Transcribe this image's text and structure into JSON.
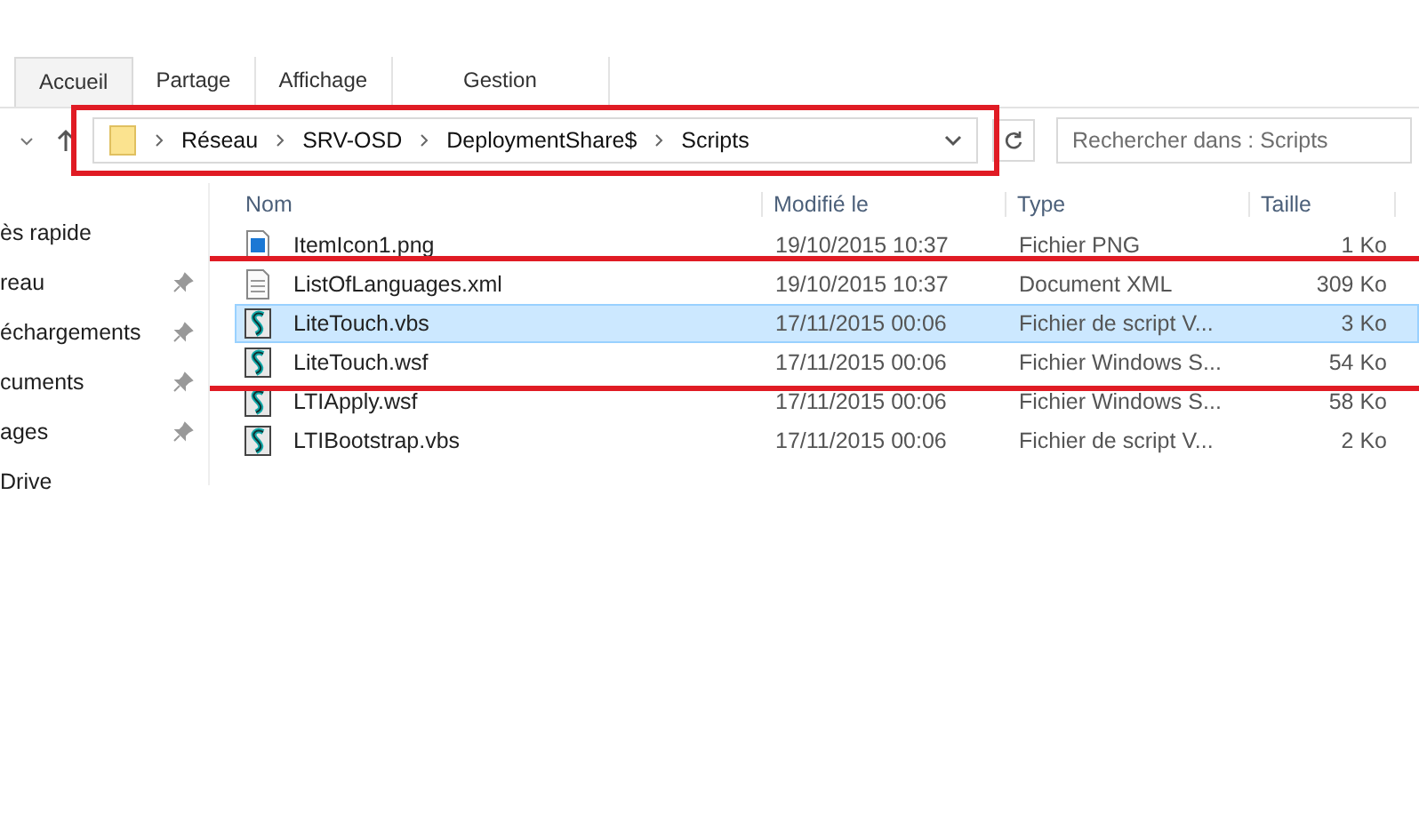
{
  "ribbon": {
    "tabs": [
      {
        "label": "Accueil",
        "selected": true
      },
      {
        "label": "Partage",
        "selected": false
      },
      {
        "label": "Affichage",
        "selected": false
      },
      {
        "label": "Gestion",
        "selected": false
      }
    ]
  },
  "address_bar": {
    "highlighted": true,
    "path": [
      "Réseau",
      "SRV-OSD",
      "DeploymentShare$",
      "Scripts"
    ]
  },
  "search": {
    "placeholder": "Rechercher dans : Scripts"
  },
  "nav_pane": {
    "items": [
      {
        "label": "ès rapide",
        "pinned": false
      },
      {
        "label": "reau",
        "pinned": true
      },
      {
        "label": "échargements",
        "pinned": true
      },
      {
        "label": "cuments",
        "pinned": true
      },
      {
        "label": "ages",
        "pinned": true
      },
      {
        "label": "Drive",
        "pinned": false
      }
    ]
  },
  "file_list": {
    "columns": [
      "Nom",
      "Modifié le",
      "Type",
      "Taille"
    ],
    "rows": [
      {
        "kind": "image",
        "name": "ItemIcon1.png",
        "modified": "19/10/2015 10:37",
        "type": "Fichier PNG",
        "size": "1 Ko",
        "selected": false,
        "highlighted": false
      },
      {
        "kind": "document",
        "name": "ListOfLanguages.xml",
        "modified": "19/10/2015 10:37",
        "type": "Document XML",
        "size": "309 Ko",
        "selected": false,
        "highlighted": true
      },
      {
        "kind": "script",
        "name": "LiteTouch.vbs",
        "modified": "17/11/2015 00:06",
        "type": "Fichier de script V...",
        "size": "3 Ko",
        "selected": true,
        "highlighted": true
      },
      {
        "kind": "script",
        "name": "LiteTouch.wsf",
        "modified": "17/11/2015 00:06",
        "type": "Fichier Windows S...",
        "size": "54 Ko",
        "selected": false,
        "highlighted": true
      },
      {
        "kind": "script",
        "name": "LTIApply.wsf",
        "modified": "17/11/2015 00:06",
        "type": "Fichier Windows S...",
        "size": "58 Ko",
        "selected": false,
        "highlighted": false
      },
      {
        "kind": "script",
        "name": "LTIBootstrap.vbs",
        "modified": "17/11/2015 00:06",
        "type": "Fichier de script V...",
        "size": "2 Ko",
        "selected": false,
        "highlighted": false
      }
    ]
  }
}
